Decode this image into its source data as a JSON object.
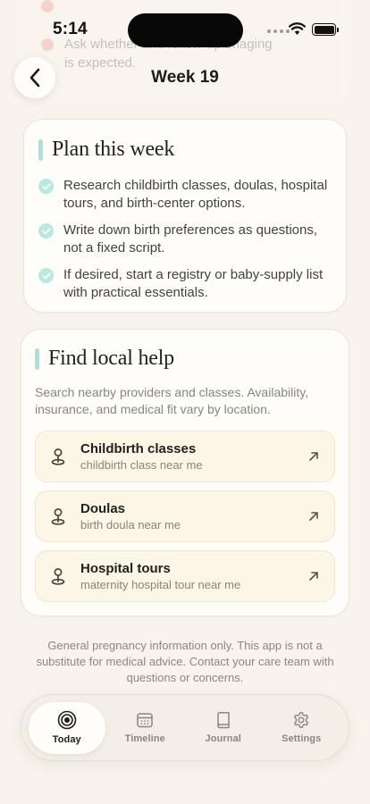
{
  "status_bar": {
    "time": "5:14"
  },
  "header": {
    "title": "Week 19",
    "back_icon": "chevron-left-icon"
  },
  "ghost_content": {
    "lines": [
      "Ask whether and follow-up imaging",
      "is expected."
    ]
  },
  "plan": {
    "title": "Plan this week",
    "accent_color": "#a8e3da",
    "items": [
      "Research childbirth classes, doulas, hospital tours, and birth-center options.",
      "Write down birth preferences as questions, not a fixed script.",
      "If desired, start a registry or baby-supply list with practical essentials."
    ]
  },
  "local_help": {
    "title": "Find local help",
    "description": "Search nearby providers and classes. Availability, insurance, and medical fit vary by location.",
    "items": [
      {
        "title": "Childbirth classes",
        "query": "childbirth class near me",
        "icon": "map-pin-icon"
      },
      {
        "title": "Doulas",
        "query": "birth doula near me",
        "icon": "map-pin-icon"
      },
      {
        "title": "Hospital tours",
        "query": "maternity hospital tour near me",
        "icon": "map-pin-icon"
      }
    ]
  },
  "disclaimer": "General pregnancy information only. This app is not a substitute for medical advice. Contact your care team with questions or concerns.",
  "tabs": [
    {
      "label": "Today",
      "icon": "target-icon",
      "active": true
    },
    {
      "label": "Timeline",
      "icon": "calendar-icon",
      "active": false
    },
    {
      "label": "Journal",
      "icon": "book-icon",
      "active": false
    },
    {
      "label": "Settings",
      "icon": "gear-icon",
      "active": false
    }
  ]
}
